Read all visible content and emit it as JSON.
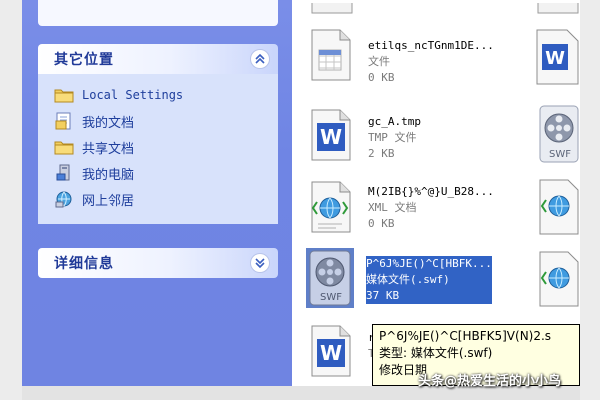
{
  "other_places": {
    "title": "其它位置",
    "items": [
      {
        "label": "Local Settings",
        "icon": "folder-icon"
      },
      {
        "label": "我的文档",
        "icon": "my-documents-icon"
      },
      {
        "label": "共享文档",
        "icon": "folder-icon"
      },
      {
        "label": "我的电脑",
        "icon": "computer-icon"
      },
      {
        "label": "网上邻居",
        "icon": "network-icon"
      }
    ]
  },
  "details": {
    "title": "详细信息"
  },
  "files": [
    {
      "name": "etilqs_ncTGnm1DE...",
      "type": "文件",
      "size": "0 KB"
    },
    {
      "name": "gc_A.tmp",
      "type": "TMP 文件",
      "size": "2 KB"
    },
    {
      "name": "M(2IB{}%^@}U_B28...",
      "type": "XML 文档",
      "size": "0 KB"
    },
    {
      "name": "P^6J%JE()^C[HBFK...",
      "type": "媒体文件(.swf)",
      "size": "37 KB",
      "selected": true
    },
    {
      "name": "r",
      "type": "T",
      "size": ""
    }
  ],
  "tooltip": {
    "line1": "P^6J%JE()^C[HBFK5]V(N)2.s",
    "line2": "类型: 媒体文件(.swf)",
    "line3": "修改日期"
  },
  "watermark": "头条@热爱生活的小小鸟",
  "colors": {
    "taskpane_bg": "#6f85e4",
    "panel_title": "#203a98",
    "link": "#1e3e9c",
    "selection": "#3163c5",
    "tooltip_bg": "#ffffe1"
  }
}
